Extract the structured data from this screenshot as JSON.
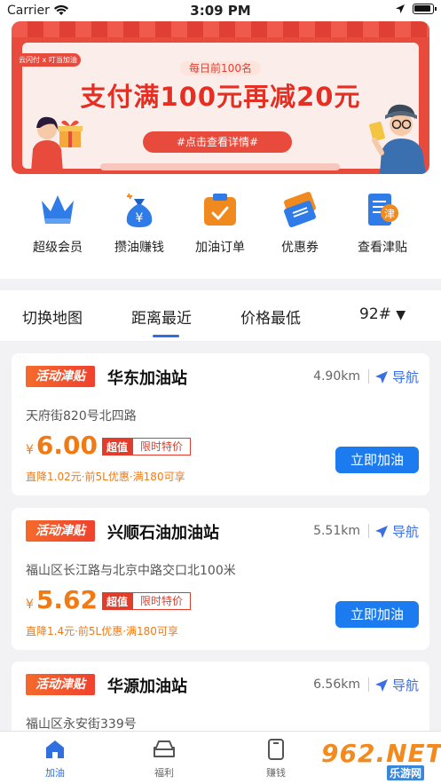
{
  "status_bar": {
    "carrier": "Carrier",
    "time": "3:09 PM"
  },
  "banner": {
    "tag": "云闪付 x 叮当加油",
    "subtitle": "每日前100名",
    "title": "支付满100元再减20元",
    "button": "#点击查看详情#"
  },
  "quick_actions": [
    {
      "label": "超级会员",
      "icon": "crown-icon"
    },
    {
      "label": "攒油赚钱",
      "icon": "money-bag-icon"
    },
    {
      "label": "加油订单",
      "icon": "order-icon"
    },
    {
      "label": "优惠券",
      "icon": "coupon-icon"
    },
    {
      "label": "查看津贴",
      "icon": "allowance-icon"
    }
  ],
  "filters": {
    "switch_map": "切换地图",
    "nearest": "距离最近",
    "cheapest": "价格最低",
    "fuel": "92#"
  },
  "stations": [
    {
      "tag": "活动津贴",
      "name": "华东加油站",
      "distance": "4.90km",
      "nav": "导航",
      "address": "天府街820号北四路",
      "yen": "¥",
      "price": "6.00",
      "badge1": "超值",
      "badge2": "限时特价",
      "promo": "直降1.02元·前5L优惠·满180可享",
      "button": "立即加油"
    },
    {
      "tag": "活动津贴",
      "name": "兴顺石油加油站",
      "distance": "5.51km",
      "nav": "导航",
      "address": "福山区长江路与北京中路交口北100米",
      "yen": "¥",
      "price": "5.62",
      "badge1": "超值",
      "badge2": "限时特价",
      "promo": "直降1.4元·前5L优惠·满180可享",
      "button": "立即加油"
    },
    {
      "tag": "活动津贴",
      "name": "华源加油站",
      "distance": "6.56km",
      "nav": "导航",
      "address": "福山区永安街339号"
    }
  ],
  "tabs": [
    {
      "label": "加油",
      "icon": "home-icon",
      "active": true
    },
    {
      "label": "福利",
      "icon": "car-icon"
    },
    {
      "label": "赚钱",
      "icon": "phone-icon"
    }
  ],
  "watermark": {
    "main": "962.NET",
    "sub": "乐游网"
  },
  "colors": {
    "accent": "#1d7bf0",
    "price": "#f07a14",
    "tag": "#f0412e",
    "tab_active": "#2f6fe0"
  }
}
